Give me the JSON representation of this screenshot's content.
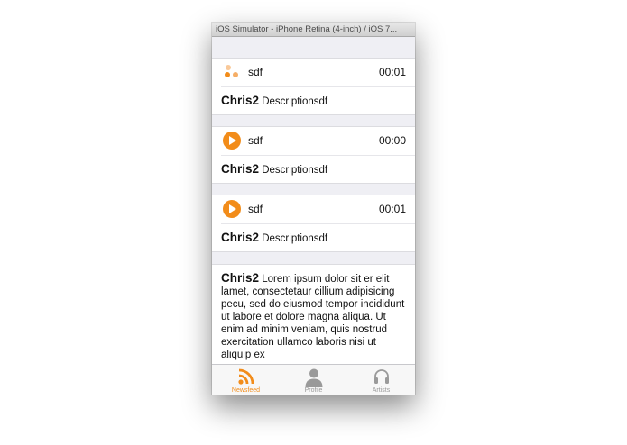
{
  "window": {
    "title": "iOS Simulator - iPhone Retina (4-inch) / iOS 7..."
  },
  "feed": {
    "items": [
      {
        "title": "sdf",
        "time": "00:01",
        "author": "Chris2",
        "description": "Descriptionsdf",
        "icon": "loading-dots-icon"
      },
      {
        "title": "sdf",
        "time": "00:00",
        "author": "Chris2",
        "description": "Descriptionsdf",
        "icon": "play-icon"
      },
      {
        "title": "sdf",
        "time": "00:01",
        "author": "Chris2",
        "description": "Descriptionsdf",
        "icon": "play-icon"
      }
    ],
    "text_post": {
      "author": "Chris2",
      "body": "Lorem ipsum dolor sit er elit lamet, consectetaur cillium adipisicing pecu, sed do eiusmod tempor incididunt ut labore et dolore magna aliqua. Ut enim ad minim veniam, quis nostrud exercitation ullamco laboris nisi ut aliquip ex"
    }
  },
  "tabbar": {
    "tabs": [
      {
        "label": "Newsfeed",
        "icon": "rss-icon",
        "active": true
      },
      {
        "label": "Profile",
        "icon": "person-icon",
        "active": false
      },
      {
        "label": "Artists",
        "icon": "headphones-icon",
        "active": false
      }
    ]
  },
  "colors": {
    "accent": "#f28c1a",
    "tab_inactive": "#9a9a9a"
  }
}
